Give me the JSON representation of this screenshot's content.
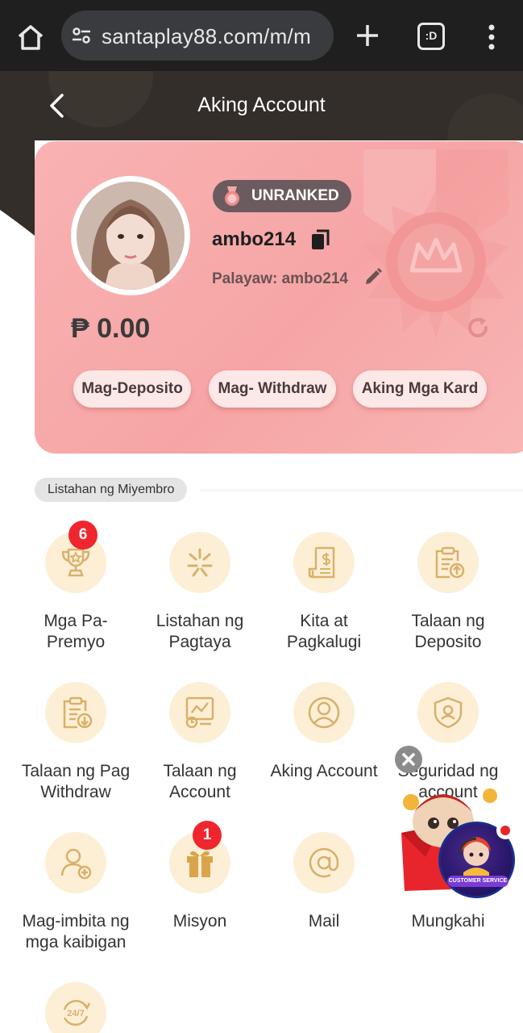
{
  "browser": {
    "url": "santaplay88.com/m/m",
    "tabs_label": ":D"
  },
  "header": {
    "title": "Aking Account"
  },
  "profile": {
    "rank": "UNRANKED",
    "username": "ambo214",
    "nickname": "Palayaw: ambo214",
    "balance": "₱ 0.00",
    "actions": {
      "deposit": "Mag-Deposito",
      "withdraw": "Mag- Withdraw",
      "cards": "Aking Mga Kard"
    }
  },
  "section": {
    "title": "Listahan ng Miyembro"
  },
  "menu": [
    {
      "label": "Mga Pa-\nPremyo",
      "badge": "6"
    },
    {
      "label": "Listahan ng\nPagtaya"
    },
    {
      "label": "Kita at\nPagkalugi"
    },
    {
      "label": "Talaan ng\nDeposito"
    },
    {
      "label": "Talaan ng Pag\nWithdraw"
    },
    {
      "label": "Talaan ng\nAccount"
    },
    {
      "label": "Aking Account"
    },
    {
      "label": "Seguridad ng\naccount"
    },
    {
      "label": "Mag-imbita ng\nmga kaibigan"
    },
    {
      "label": "Misyon",
      "badge": "1"
    },
    {
      "label": "Mail"
    },
    {
      "label": "Mungkahi"
    },
    {
      "label": ""
    }
  ],
  "widget": {
    "label": "CUSTOMER SERVICE"
  },
  "colors": {
    "accent_card": "#f6a5a5",
    "icon_bg": "#fdefd6",
    "icon_stroke": "#d9b06a",
    "badge": "#f0252e",
    "header_bg": "#332e2a"
  }
}
